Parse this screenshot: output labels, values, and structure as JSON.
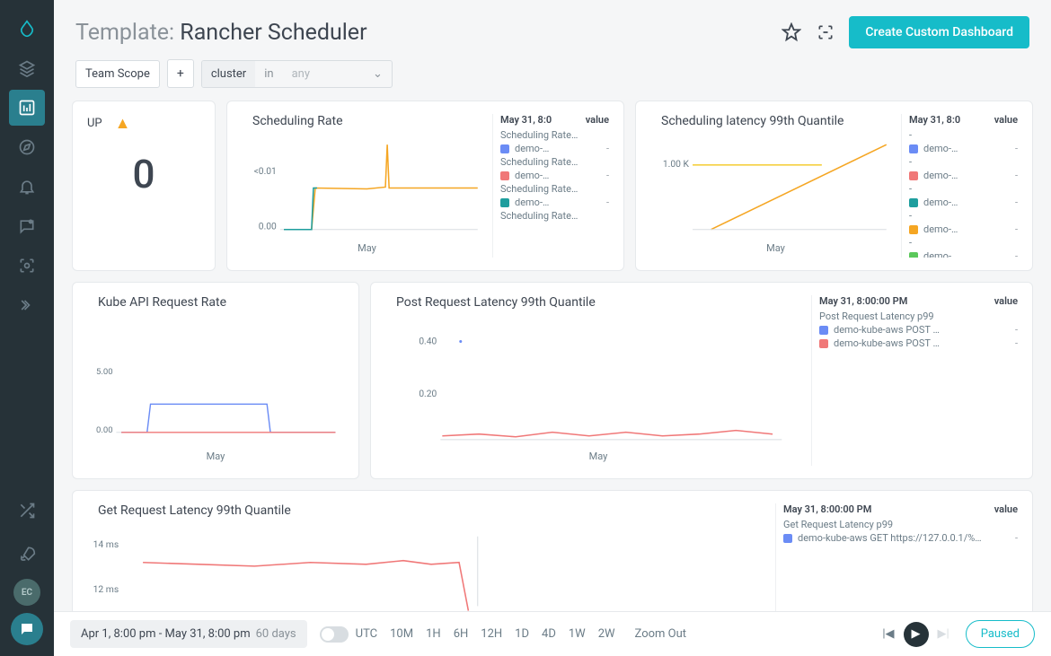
{
  "header": {
    "prefix": "Template: ",
    "title": "Rancher Scheduler",
    "create_button": "Create Custom Dashboard"
  },
  "scope": {
    "team_scope": "Team Scope",
    "add": "+",
    "cluster_label": "cluster",
    "in_label": "in",
    "any_placeholder": "any"
  },
  "sidebar_avatar": "EC",
  "cards": {
    "up": {
      "title": "UP",
      "value": "0"
    },
    "sched_rate": {
      "title": "Scheduling Rate",
      "xlabel": "May",
      "ytick_top": "<0.01",
      "ytick_bottom": "0.00",
      "legend_header": "May 31, 8:0",
      "legend_header_val": "value",
      "groups": [
        {
          "title": "Scheduling Rate…",
          "items": [
            {
              "color": "#6b8cf5",
              "label": "demo-…",
              "val": "-"
            }
          ]
        },
        {
          "title": "Scheduling Rate…",
          "items": [
            {
              "color": "#f07878",
              "label": "demo-…",
              "val": "-"
            }
          ]
        },
        {
          "title": "Scheduling Rate…",
          "items": [
            {
              "color": "#1e9e9e",
              "label": "demo-…",
              "val": "-"
            }
          ]
        },
        {
          "title": "Scheduling Rate…",
          "items": []
        }
      ]
    },
    "sched_lat": {
      "title": "Scheduling latency 99th Quantile",
      "xlabel": "May",
      "ytick": "1.00 K",
      "legend_header": "May 31, 8:0",
      "legend_header_val": "value",
      "items": [
        {
          "color": "#6b8cf5",
          "label": "demo-…",
          "val": "-"
        },
        {
          "color": "#f07878",
          "label": "demo-…",
          "val": "-"
        },
        {
          "color": "#1e9e9e",
          "label": "demo-…",
          "val": "-"
        },
        {
          "color": "#f5a623",
          "label": "demo-…",
          "val": "-"
        },
        {
          "color": "#5bc85b",
          "label": "demo-…",
          "val": "-"
        }
      ]
    },
    "kube_api": {
      "title": "Kube API Request Rate",
      "xlabel": "May",
      "ytick_top": "5.00",
      "ytick_bottom": "0.00"
    },
    "post_lat": {
      "title": "Post Request Latency 99th Quantile",
      "xlabel": "May",
      "ytick_top": "0.40",
      "ytick_mid": "0.20",
      "legend_header": "May 31, 8:00:00 PM",
      "legend_header_val": "value",
      "group_title": "Post Request Latency p99",
      "items": [
        {
          "color": "#6b8cf5",
          "label": "demo-kube-aws POST …",
          "val": "-"
        },
        {
          "color": "#f07878",
          "label": "demo-kube-aws POST …",
          "val": "-"
        }
      ]
    },
    "get_lat": {
      "title": "Get Request Latency 99th Quantile",
      "ytick_top": "14 ms",
      "ytick_bottom": "12 ms",
      "legend_header": "May 31, 8:00:00 PM",
      "legend_header_val": "value",
      "group_title": "Get Request Latency p99",
      "items": [
        {
          "color": "#6b8cf5",
          "label": "demo-kube-aws GET https://127.0.0.1/%…",
          "val": "-"
        }
      ]
    }
  },
  "timebar": {
    "range": "Apr 1, 8:00 pm - May 31, 8:00 pm",
    "days": "60 days",
    "utc": "UTC",
    "ranges": [
      "10M",
      "1H",
      "6H",
      "12H",
      "1D",
      "4D",
      "1W",
      "2W"
    ],
    "zoom_out": "Zoom Out",
    "paused": "Paused"
  },
  "chart_data": [
    {
      "type": "line",
      "title": "Scheduling Rate",
      "xlabel": "May",
      "ylabel": "",
      "ylim": [
        0,
        0.01
      ],
      "series": [
        {
          "name": "demo- (blue)",
          "x": [
            0,
            18,
            20,
            100
          ],
          "values": [
            0,
            0,
            0.005,
            0.005
          ]
        },
        {
          "name": "demo- (orange)",
          "x": [
            0,
            18,
            20,
            58,
            60,
            62,
            100
          ],
          "values": [
            0,
            0,
            0.005,
            0.005,
            0.0095,
            0.005,
            0.005
          ]
        },
        {
          "name": "demo- (red)",
          "x": [
            0,
            100
          ],
          "values": [
            0,
            0
          ]
        }
      ]
    },
    {
      "type": "line",
      "title": "Scheduling latency 99th Quantile",
      "xlabel": "May",
      "ylim": [
        0,
        1800
      ],
      "series": [
        {
          "name": "yellow-flat",
          "x": [
            0,
            65
          ],
          "values": [
            1000,
            1000
          ]
        },
        {
          "name": "orange-rise",
          "x": [
            10,
            100
          ],
          "values": [
            0,
            1700
          ]
        }
      ]
    },
    {
      "type": "line",
      "title": "Kube API Request Rate",
      "xlabel": "May",
      "ylim": [
        0,
        8
      ],
      "series": [
        {
          "name": "blue",
          "x": [
            0,
            12,
            14,
            70,
            72,
            100
          ],
          "values": [
            0,
            0,
            2.2,
            2.2,
            0,
            0
          ]
        },
        {
          "name": "red",
          "x": [
            0,
            100
          ],
          "values": [
            0,
            0
          ]
        }
      ]
    },
    {
      "type": "line",
      "title": "Post Request Latency 99th Quantile",
      "xlabel": "May",
      "ylim": [
        0,
        0.5
      ],
      "series": [
        {
          "name": "red",
          "x": [
            0,
            100
          ],
          "values": [
            0.03,
            0.04
          ]
        },
        {
          "name": "blue-point",
          "x": [
            10
          ],
          "values": [
            0.4
          ]
        }
      ]
    },
    {
      "type": "line",
      "title": "Get Request Latency 99th Quantile",
      "ylim": [
        10,
        16
      ],
      "series": [
        {
          "name": "red",
          "x": [
            0,
            42,
            45,
            100
          ],
          "values": [
            13.5,
            13.5,
            10,
            10
          ]
        }
      ]
    }
  ]
}
